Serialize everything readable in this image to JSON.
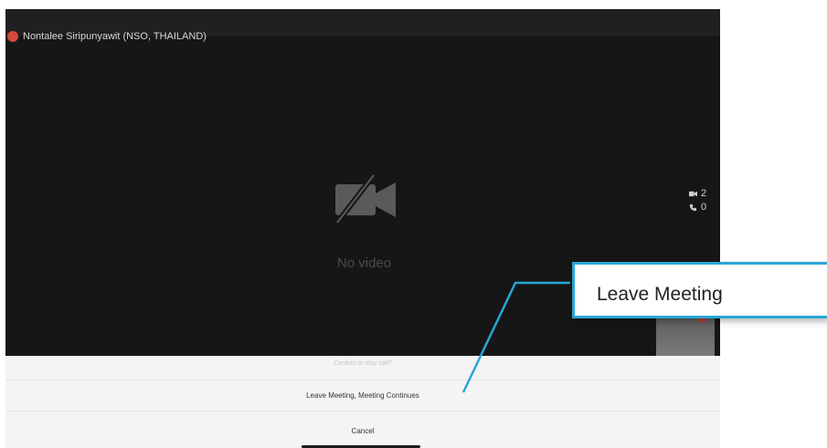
{
  "video": {
    "participant_name": "Nontalee Siripunyawit (NSO, THAILAND)",
    "no_video_label": "No video",
    "stats": {
      "video_count": "2",
      "call_count": "0"
    },
    "icons": {
      "video_off": "video-off-icon",
      "video": "video-icon",
      "phone": "phone-icon",
      "participant_status": "status-dot-icon"
    }
  },
  "dialog": {
    "title": "Confirm or stay call?",
    "option_leave": "Leave Meeting, Meeting Continues",
    "option_cancel": "Cancel"
  },
  "callout": {
    "label": "Leave Meeting",
    "accent": "#29a6d6"
  }
}
